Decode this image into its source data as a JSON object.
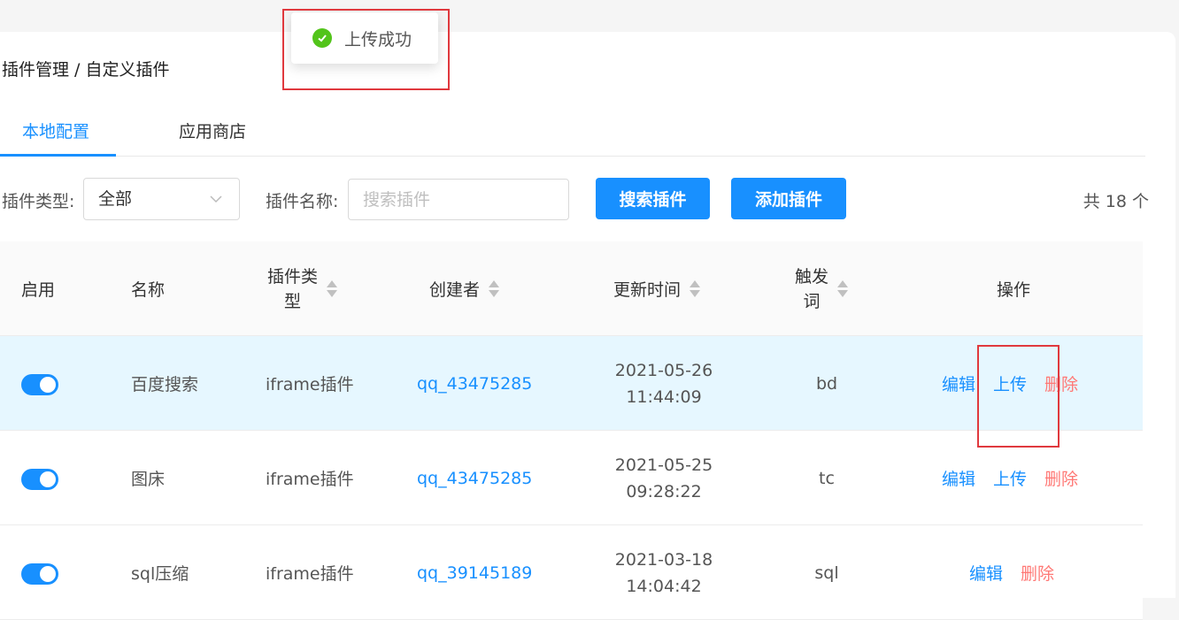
{
  "toast": {
    "message": "上传成功",
    "icon": "check-circle-icon",
    "color": "#52c41a"
  },
  "breadcrumb": "插件管理 / 自定义插件",
  "tabs": [
    {
      "label": "本地配置",
      "active": true
    },
    {
      "label": "应用商店",
      "active": false
    }
  ],
  "filters": {
    "type_label": "插件类型:",
    "type_value": "全部",
    "name_label": "插件名称:",
    "name_placeholder": "搜索插件",
    "search_button": "搜索插件",
    "add_button": "添加插件",
    "total": "共 18 个"
  },
  "table": {
    "headers": {
      "enabled": "启用",
      "name": "名称",
      "type_line1": "插件类",
      "type_line2": "型",
      "creator": "创建者",
      "updated": "更新时间",
      "trigger_line1": "触发",
      "trigger_line2": "词",
      "actions": "操作"
    },
    "rows": [
      {
        "enabled": true,
        "name": "百度搜索",
        "type": "iframe插件",
        "creator": "qq_43475285",
        "date": "2021-05-26",
        "time": "11:44:09",
        "trigger": "bd",
        "actions": [
          "编辑",
          "上传",
          "删除"
        ],
        "highlighted": true
      },
      {
        "enabled": true,
        "name": "图床",
        "type": "iframe插件",
        "creator": "qq_43475285",
        "date": "2021-05-25",
        "time": "09:28:22",
        "trigger": "tc",
        "actions": [
          "编辑",
          "上传",
          "删除"
        ],
        "highlighted": false
      },
      {
        "enabled": true,
        "name": "sql压缩",
        "type": "iframe插件",
        "creator": "qq_39145189",
        "date": "2021-03-18",
        "time": "14:04:42",
        "trigger": "sql",
        "actions": [
          "编辑",
          "删除"
        ],
        "highlighted": false
      }
    ]
  },
  "colors": {
    "primary": "#1890ff",
    "danger": "#ff7875",
    "row_highlight": "#e6f7ff",
    "annotation": "#e0393e"
  }
}
